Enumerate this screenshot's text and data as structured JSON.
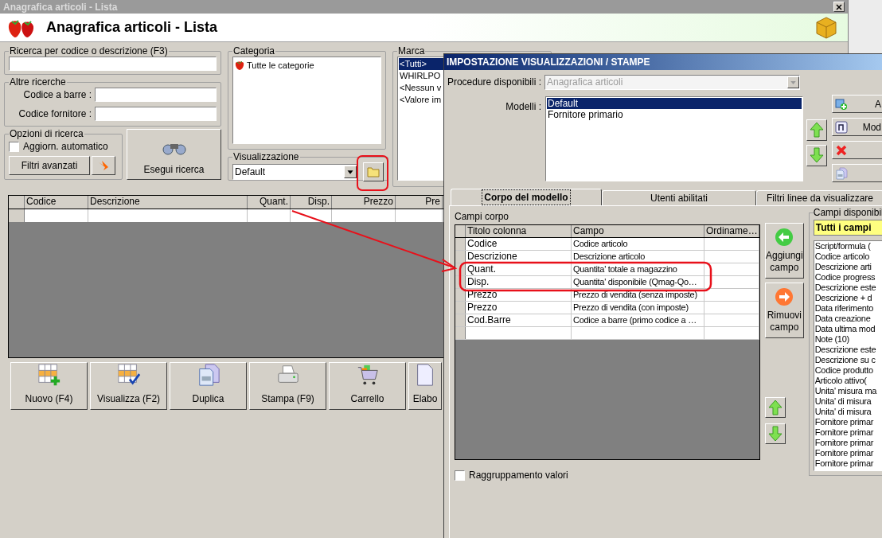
{
  "main_window": {
    "title": "Anagrafica articoli  - Lista",
    "heading": "Anagrafica articoli  - Lista"
  },
  "search": {
    "title": "Ricerca per codice o descrizione (F3)"
  },
  "other_searches": {
    "title": "Altre ricerche",
    "fields": [
      {
        "label": "Codice a barre :"
      },
      {
        "label": "Codice fornitore :"
      }
    ]
  },
  "search_options": {
    "title": "Opzioni di ricerca",
    "auto_refresh": {
      "label": "Aggiorn. automatico",
      "checked": false
    },
    "advanced_filters_button": "Filtri avanzati"
  },
  "run_search_button": "Esegui ricerca",
  "category": {
    "title": "Categoria",
    "items": [
      "Tutte le categorie"
    ]
  },
  "view": {
    "title": "Visualizzazione",
    "value": "Default"
  },
  "brand": {
    "title": "Marca",
    "items": [
      {
        "label": "<Tutti>",
        "selected": true
      },
      {
        "label": "WHIRLPO",
        "selected": false
      },
      {
        "label": "<Nessun v",
        "selected": false
      },
      {
        "label": "<Valore im",
        "selected": false
      }
    ]
  },
  "grid": {
    "columns": [
      "Codice",
      "Descrizione",
      "Quant.",
      "Disp.",
      "Prezzo",
      "Pre"
    ]
  },
  "actions": [
    {
      "label": "Nuovo (F4)",
      "kind": "new"
    },
    {
      "label": "Visualizza (F2)",
      "kind": "view"
    },
    {
      "label": "Duplica",
      "kind": "duplicate"
    },
    {
      "label": "Stampa (F9)",
      "kind": "print"
    },
    {
      "label": "Carrello",
      "kind": "cart"
    },
    {
      "label": "Elabo",
      "kind": "process"
    }
  ],
  "dialog": {
    "title": "IMPOSTAZIONE VISUALIZZAZIONI / STAMPE",
    "procedure": {
      "label": "Procedure disponibili :",
      "value": "Anagrafica articoli",
      "disabled": true
    },
    "models": {
      "label": "Modelli :",
      "items": [
        {
          "label": "Default",
          "selected": true
        },
        {
          "label": "Fornitore primario",
          "selected": false
        }
      ]
    },
    "model_buttons": [
      {
        "kind": "add",
        "label": "A"
      },
      {
        "kind": "edit",
        "label": "Mod"
      },
      {
        "kind": "delete"
      },
      {
        "kind": "copy"
      }
    ],
    "tabs": [
      {
        "label": "Corpo del modello",
        "selected": true
      },
      {
        "label": "Utenti abilitati",
        "selected": false
      },
      {
        "label": "Filtri linee da visualizzare",
        "selected": false
      }
    ],
    "body_fields": {
      "title": "Campi corpo",
      "columns": [
        "Titolo colonna",
        "Campo",
        "Ordiname…"
      ],
      "rows": [
        {
          "title": "Codice",
          "field": "Codice articolo"
        },
        {
          "title": "Descrizione",
          "field": "Descrizione articolo"
        },
        {
          "title": "Quant.",
          "field": "Quantita' totale a magazzino"
        },
        {
          "title": "Disp.",
          "field": "Quantita' disponibile (Qmag-Qo…"
        },
        {
          "title": "Prezzo",
          "field": "Prezzo di vendita (senza imposte)"
        },
        {
          "title": "Prezzo",
          "field": "Prezzo di vendita (con imposte)"
        },
        {
          "title": "Cod.Barre",
          "field": "Codice a barre (primo codice a …"
        }
      ]
    },
    "add_field_button": "Aggiungi campo",
    "remove_field_button": "Rimuovi campo",
    "available_fields": {
      "title": "Campi disponibil",
      "filter": "Tutti i campi",
      "items": [
        "Script/formula (",
        "Codice articolo",
        "Descrizione arti",
        "Codice progress",
        "Descrizione este",
        "Descrizione + d",
        "Data riferimento",
        "Data creazione",
        "Data ultima mod",
        "Note (10)",
        "Descrizione este",
        "Descrizione su c",
        "Codice produtto",
        "Articolo attivo(",
        "Unita' misura ma",
        "Unita' di misura",
        "Unita' di misura",
        "Fornitore primar",
        "Fornitore primar",
        "Fornitore primar",
        "Fornitore primar",
        "Fornitore primar"
      ]
    },
    "grouping": {
      "label": "Raggruppamento valori",
      "checked": false
    }
  }
}
